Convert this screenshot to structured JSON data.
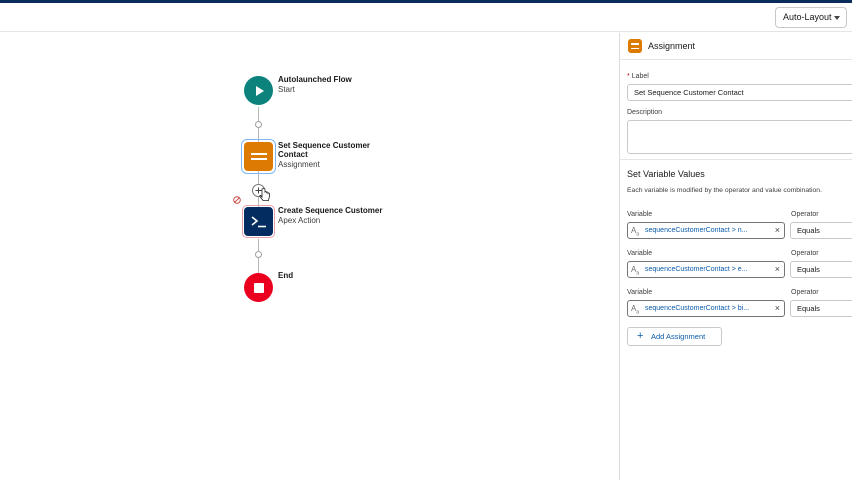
{
  "toolbar": {
    "layout_value": "Auto-Layout"
  },
  "flow": {
    "start": {
      "title": "Autolaunched Flow",
      "subtitle": "Start"
    },
    "assignment": {
      "title_line1": "Set Sequence Customer",
      "title_line2": "Contact",
      "subtitle": "Assignment"
    },
    "apex": {
      "title": "Create Sequence Customer",
      "subtitle": "Apex Action"
    },
    "end": {
      "title": "End"
    }
  },
  "colors": {
    "start": "#0b827c",
    "assignment": "#dd7a01",
    "apex": "#032d60",
    "end": "#ea001e",
    "link": "#0b5cab"
  },
  "panel": {
    "title": "Assignment",
    "label_caption": "Label",
    "required_mark": "*",
    "label_value": "Set Sequence Customer Contact",
    "description_caption": "Description",
    "section_title": "Set Variable Values",
    "help_text": "Each variable is modified by the operator and value combination.",
    "rows": [
      {
        "variable_caption": "Variable",
        "operator_caption": "Operator",
        "variable": "sequenceCustomerContact > n...",
        "operator": "Equals"
      },
      {
        "variable_caption": "Variable",
        "operator_caption": "Operator",
        "variable": "sequenceCustomerContact > e...",
        "operator": "Equals"
      },
      {
        "variable_caption": "Variable",
        "operator_caption": "Operator",
        "variable": "sequenceCustomerContact > bi...",
        "operator": "Equals"
      }
    ],
    "add_button": "Add Assignment"
  }
}
